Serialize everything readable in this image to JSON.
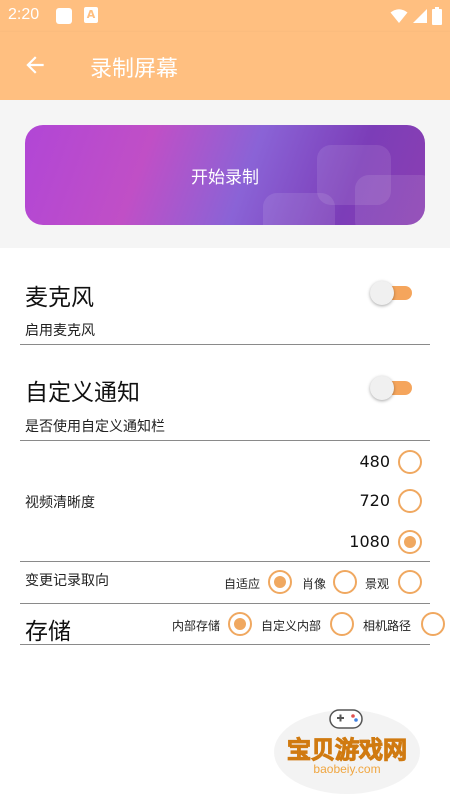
{
  "status_bar": {
    "time": "2:20",
    "icons": [
      "notification-square-icon",
      "app-a-icon",
      "wifi-icon",
      "signal-icon",
      "battery-icon"
    ]
  },
  "app_bar": {
    "back_icon": "arrow-left-icon",
    "title": "录制屏幕"
  },
  "start_button": {
    "label": "开始录制"
  },
  "microphone": {
    "title": "麦克风",
    "subtitle": "启用麦克风",
    "enabled": true
  },
  "custom_notification": {
    "title": "自定义通知",
    "subtitle": "是否使用自定义通知栏",
    "enabled": true
  },
  "resolution": {
    "label": "视频清晰度",
    "options": [
      {
        "label": "480",
        "selected": false
      },
      {
        "label": "720",
        "selected": false
      },
      {
        "label": "1080",
        "selected": true
      }
    ]
  },
  "orientation": {
    "label": "变更记录取向",
    "options": [
      {
        "label": "自适应",
        "selected": true
      },
      {
        "label": "肖像",
        "selected": false
      },
      {
        "label": "景观",
        "selected": false
      }
    ]
  },
  "storage": {
    "label": "存储",
    "options": [
      {
        "label": "内部存储",
        "selected": true
      },
      {
        "label": "自定义内部",
        "selected": false
      },
      {
        "label": "相机路径",
        "selected": false
      }
    ]
  },
  "watermark": {
    "title": "宝贝游戏网",
    "url": "baobeiy.com"
  },
  "colors": {
    "accent": "#ffbf80",
    "toggle_track": "#f5a55c",
    "radio": "#f0a860",
    "button_gradient": [
      "#b146d6",
      "#8a63d6",
      "#8b3fb2"
    ]
  }
}
